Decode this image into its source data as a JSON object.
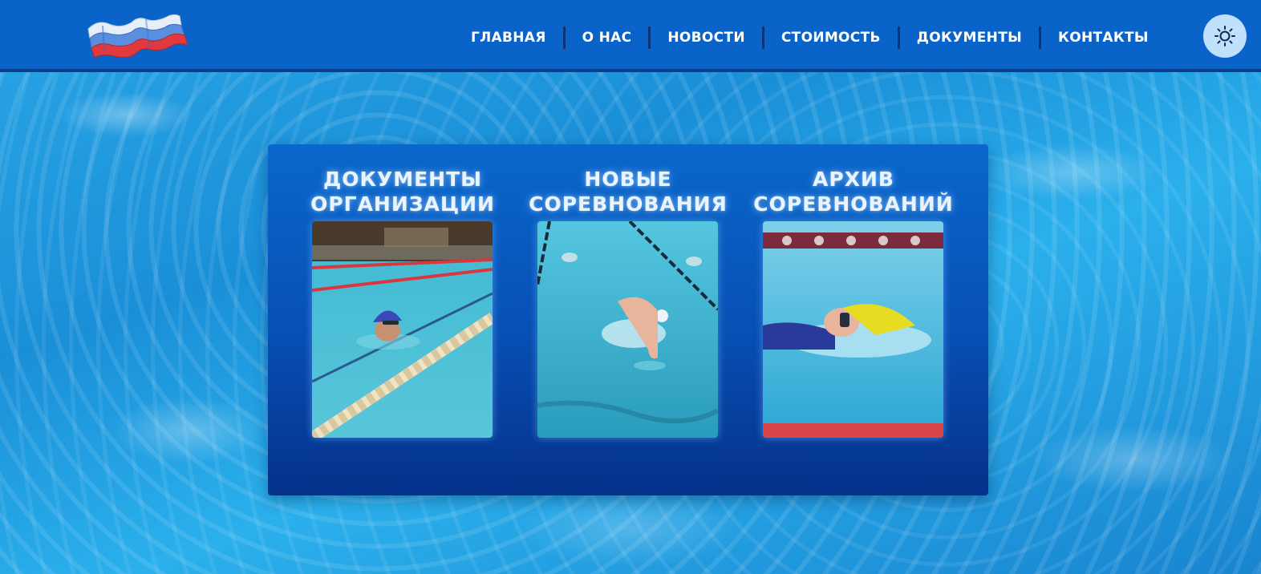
{
  "header": {
    "nav": [
      "ГЛАВНАЯ",
      "О НАС",
      "НОВОСТИ",
      "СТОИМОСТЬ",
      "ДОКУМЕНТЫ",
      "КОНТАКТЫ"
    ],
    "theme_icon": "sun-icon",
    "logo_icon": "russian-flag-waves-logo"
  },
  "cards": [
    {
      "title": "ДОКУМЕНТЫ\nОРГАНИЗАЦИИ",
      "image": "swimmer-purple-cap-photo"
    },
    {
      "title": "НОВЫЕ\nСОРЕВНОВАНИЯ",
      "image": "swimmer-freestyle-lanes-photo"
    },
    {
      "title": "АРХИВ\nСОРЕВНОВАНИЙ",
      "image": "swimmer-yellow-cap-photo"
    }
  ],
  "colors": {
    "header_bg": "#0a63c8",
    "panel_top": "#0a67cc",
    "panel_bottom": "#05318a",
    "water": "#2aa6e6",
    "theme_button": "#bfe1fb"
  }
}
